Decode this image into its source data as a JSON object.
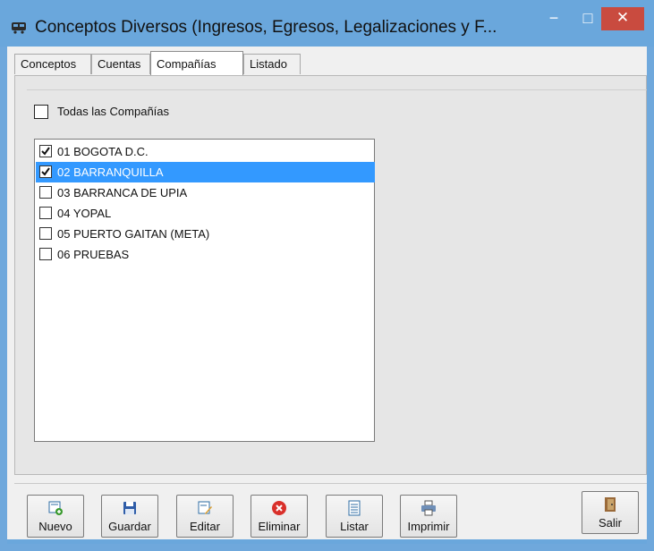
{
  "window": {
    "title": "Conceptos Diversos (Ingresos, Egresos, Legalizaciones y F...",
    "controls": {
      "minimize": "−",
      "maximize": "□",
      "close": "✕"
    },
    "app_icon": "bus-icon",
    "colors": {
      "titlebar": "#6aa7dc",
      "close": "#c94b3f",
      "selection": "#3399ff"
    }
  },
  "tabs": [
    {
      "label": "Conceptos",
      "active": false
    },
    {
      "label": "Cuentas",
      "active": false
    },
    {
      "label": "Compañías",
      "active": true
    },
    {
      "label": "Listado",
      "active": false
    }
  ],
  "todas": {
    "label": "Todas las Compañías",
    "checked": false
  },
  "companies": [
    {
      "label": "01 BOGOTA D.C.",
      "checked": true,
      "selected": false
    },
    {
      "label": "02 BARRANQUILLA",
      "checked": true,
      "selected": true
    },
    {
      "label": "03 BARRANCA DE UPIA",
      "checked": false,
      "selected": false
    },
    {
      "label": "04 YOPAL",
      "checked": false,
      "selected": false
    },
    {
      "label": "05 PUERTO GAITAN  (META)",
      "checked": false,
      "selected": false
    },
    {
      "label": "06 PRUEBAS",
      "checked": false,
      "selected": false
    }
  ],
  "buttons": {
    "nuevo": "Nuevo",
    "guardar": "Guardar",
    "editar": "Editar",
    "eliminar": "Eliminar",
    "listar": "Listar",
    "imprimir": "Imprimir",
    "salir": "Salir"
  }
}
